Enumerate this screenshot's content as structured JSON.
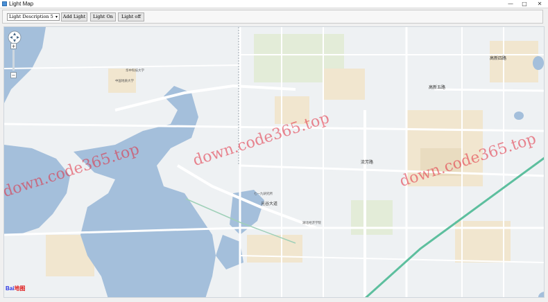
{
  "window": {
    "title": "Light Map",
    "minimize_glyph": "—",
    "maximize_glyph": "□",
    "close_glyph": "✕"
  },
  "toolbar": {
    "selector_value": "Light Description 5",
    "add_light_label": "Add Light",
    "light_on_label": "Light On",
    "light_off_label": "Light off"
  },
  "map": {
    "zoom_in": "+",
    "zoom_out": "−",
    "watermark": "down.code365.top",
    "logo_text_blue": "Bai",
    "logo_text_red": "地图",
    "road_labels": [
      "高新五路",
      "流芳路",
      "光谷大道",
      "七一九研究所",
      "湖北经济学院",
      "中国地质大学",
      "华中科技大学",
      "高新四路"
    ]
  }
}
